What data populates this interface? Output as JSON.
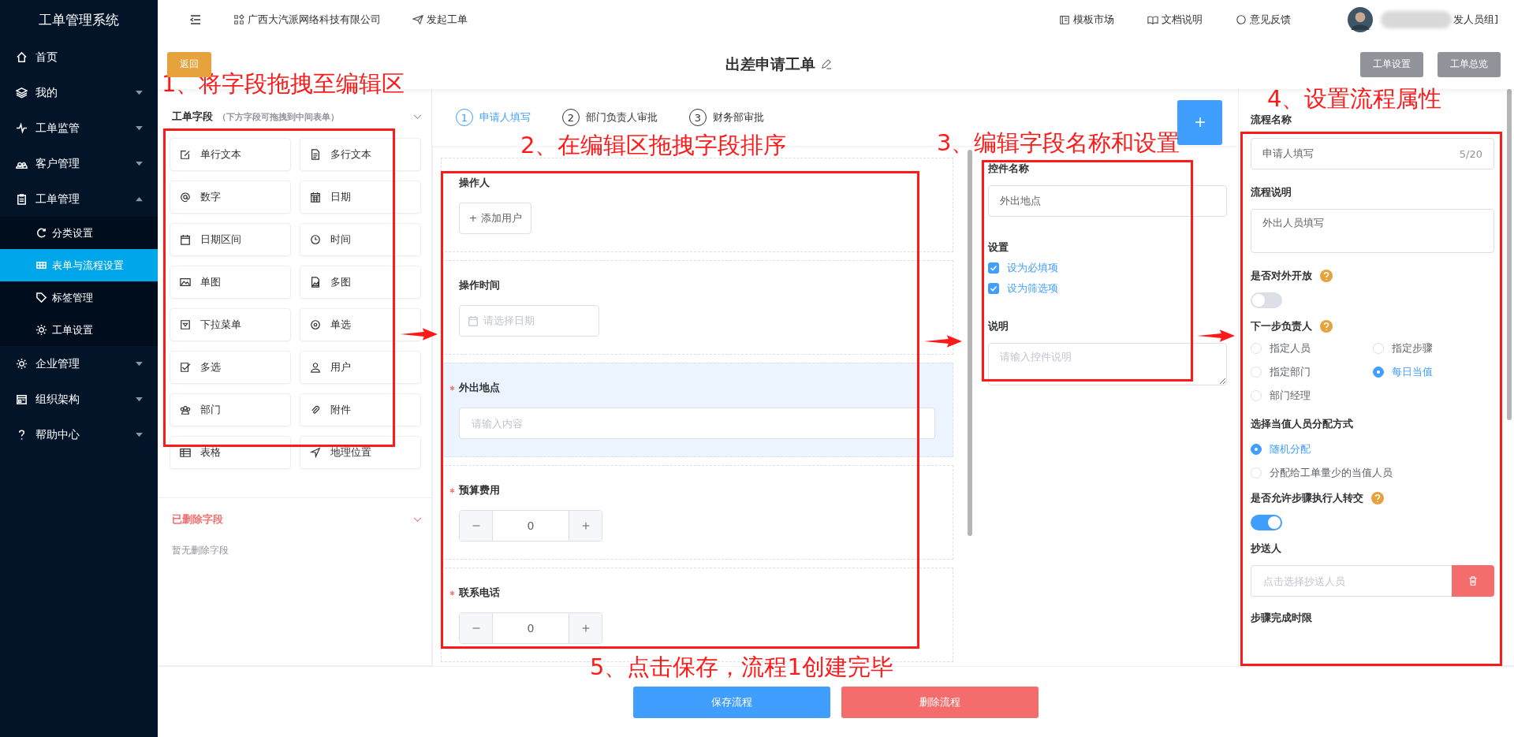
{
  "sidebar": {
    "title": "工单管理系统",
    "items": [
      {
        "label": "首页",
        "selected": false
      },
      {
        "label": "我的",
        "selected": false,
        "expanded": false
      },
      {
        "label": "工单监管",
        "selected": false,
        "expanded": false
      },
      {
        "label": "客户管理",
        "selected": false,
        "expanded": false
      },
      {
        "label": "工单管理",
        "selected": false,
        "expanded": true,
        "children": [
          {
            "label": "分类设置",
            "selected": false
          },
          {
            "label": "表单与流程设置",
            "selected": true
          },
          {
            "label": "标签管理",
            "selected": false
          },
          {
            "label": "工单设置",
            "selected": false
          }
        ]
      },
      {
        "label": "企业管理",
        "selected": false,
        "expanded": false
      },
      {
        "label": "组织架构",
        "selected": false,
        "expanded": false
      },
      {
        "label": "帮助中心",
        "selected": false,
        "expanded": false
      }
    ]
  },
  "topbar": {
    "company": "广西大汽派网络科技有限公司",
    "new_ticket": "发起工单",
    "links": [
      "模板市场",
      "文档说明",
      "意见反馈"
    ],
    "user": "发人员组]"
  },
  "header": {
    "back": "返回",
    "title": "出差申请工单",
    "buttons": [
      "工单设置",
      "工单总览"
    ]
  },
  "fields_panel": {
    "title": "工单字段",
    "hint": "（下方字段可拖拽到中间表单）",
    "fields": [
      "单行文本",
      "多行文本",
      "数字",
      "日期",
      "日期区间",
      "时间",
      "单图",
      "多图",
      "下拉菜单",
      "单选",
      "多选",
      "用户",
      "部门",
      "附件",
      "表格",
      "地理位置"
    ],
    "deleted_title": "已删除字段",
    "deleted_empty": "暂无删除字段"
  },
  "steps": [
    {
      "number": "1",
      "label": "申请人填写",
      "selected": true
    },
    {
      "number": "2",
      "label": "部门负责人审批",
      "selected": false
    },
    {
      "number": "3",
      "label": "财务部审批",
      "selected": false
    }
  ],
  "form_items": [
    {
      "kind": "user",
      "label": "操作人",
      "required": false,
      "selected": false,
      "button": "+ 添加用户"
    },
    {
      "kind": "date",
      "label": "操作时间",
      "required": false,
      "selected": false,
      "placeholder": "请选择日期"
    },
    {
      "kind": "text",
      "label": "外出地点",
      "required": true,
      "selected": true,
      "placeholder": "请输入内容"
    },
    {
      "kind": "number",
      "label": "预算费用",
      "required": true,
      "selected": false,
      "value": "0"
    },
    {
      "kind": "number",
      "label": "联系电话",
      "required": true,
      "selected": false,
      "value": "0"
    }
  ],
  "control_settings": {
    "name_label": "控件名称",
    "name_value": "外出地点",
    "settings_label": "设置",
    "options": [
      {
        "label": "设为必填项",
        "checked": true
      },
      {
        "label": "设为筛选项",
        "checked": true
      }
    ],
    "desc_label": "说明",
    "desc_placeholder": "请输入控件说明"
  },
  "flow_settings": {
    "name_label": "流程名称",
    "name_value": "申请人填写",
    "name_counter": "5/20",
    "desc_label": "流程说明",
    "desc_value": "外出人员填写",
    "public_label": "是否对外开放",
    "public_on": false,
    "next_label": "下一步负责人",
    "next_options": [
      {
        "label": "指定人员",
        "selected": false
      },
      {
        "label": "指定步骤",
        "selected": false
      },
      {
        "label": "指定部门",
        "selected": false
      },
      {
        "label": "每日当值",
        "selected": true
      },
      {
        "label": "部门经理",
        "selected": false
      }
    ],
    "assign_label": "选择当值人员分配方式",
    "assign_options": [
      {
        "label": "随机分配",
        "selected": true
      },
      {
        "label": "分配给工单量少的当值人员",
        "selected": false
      }
    ],
    "transfer_label": "是否允许步骤执行人转交",
    "transfer_on": true,
    "cc_label": "抄送人",
    "cc_placeholder": "点击选择抄送人员",
    "limit_label": "步骤完成时限"
  },
  "footer": {
    "save": "保存流程",
    "delete": "删除流程"
  },
  "annotations": [
    "1、将字段拖拽至编辑区",
    "2、在编辑区拖拽字段排序",
    "3、编辑字段名称和设置",
    "4、设置流程属性",
    "5、点击保存，流程1创建完毕"
  ]
}
